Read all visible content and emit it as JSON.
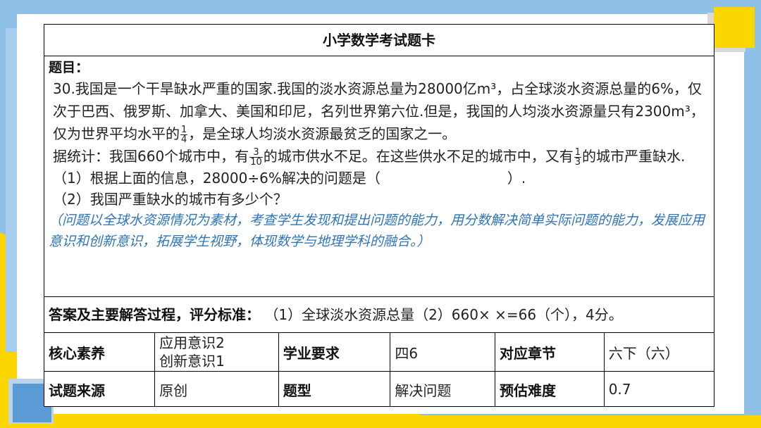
{
  "header": {
    "title": "小学数学考试题卡"
  },
  "question": {
    "label": "题目：",
    "p1_a": "30.我国是一个干旱缺水严重的国家.我国的淡水资源总量为28000亿m³，占全球淡水资源总量的6%，仅次于巴西、俄罗斯、加拿大、美国和印尼，名列世界第六位.但是，我国的人均淡水资源量只有2300m³，仅为世界平均水平的",
    "p1_frac_num": "1",
    "p1_frac_den": "4",
    "p1_b": "，是全球人均淡水资源最贫乏的国家之一。",
    "p2_a": "据统计：我国660个城市中，有",
    "p2_frac1_num": "3",
    "p2_frac1_den": "10",
    "p2_b": "的城市供水不足。在这些供水不足的城市中，又有",
    "p2_frac2_num": "1",
    "p2_frac2_den": "3",
    "p2_c": "的城市严重缺水.",
    "sub1": "（1）根据上面的信息，28000÷6%解决的问题是（　　　　　　　　　）.",
    "sub2": "（2）我国严重缺水的城市有多少个？",
    "note": "（问题以全球水资源情况为素材，考查学生发现和提出问题的能力，用分数解决简单实际问题的能力，发展应用意识和创新意识，拓展学生视野，体现数学与地理学科的融合。）"
  },
  "answer": {
    "label": "答案及主要解答过程，评分标准：",
    "text": "（1）全球淡水资源总量（2）660× ×=66（个），4分。"
  },
  "meta": {
    "core_label": "核心素养",
    "core_value_1": "应用意识2",
    "core_value_2": "创新意识1",
    "req_label": "学业要求",
    "req_value": "四6",
    "chapter_label": "对应章节",
    "chapter_value": "六下（六）",
    "source_label": "试题来源",
    "source_value": "原创",
    "type_label": "题型",
    "type_value": "解决问题",
    "difficulty_label": "预估难度",
    "difficulty_value": "0.7"
  },
  "colors": {
    "accent_blue": "#2e75b6",
    "yellow": "#fcd600",
    "background_blue": "#8ec0e8"
  }
}
